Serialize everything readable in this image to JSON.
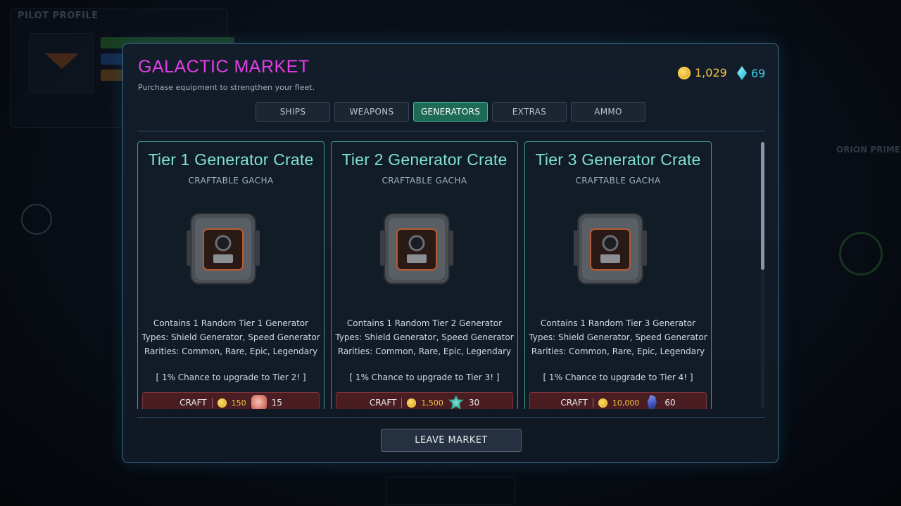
{
  "background": {
    "pilot_profile_title": "PILOT PROFILE",
    "location_name": "ORION PRIME"
  },
  "market": {
    "title": "GALACTIC MARKET",
    "subtitle": "Purchase equipment to strengthen your fleet.",
    "currency": {
      "gold": "1,029",
      "gems": "69"
    },
    "tabs": [
      {
        "label": "SHIPS",
        "active": false
      },
      {
        "label": "WEAPONS",
        "active": false
      },
      {
        "label": "GENERATORS",
        "active": true
      },
      {
        "label": "EXTRAS",
        "active": false
      },
      {
        "label": "AMMO",
        "active": false
      }
    ],
    "cards": [
      {
        "title": "Tier 1 Generator Crate",
        "subtitle": "CRAFTABLE GACHA",
        "desc_line1": "Contains 1 Random Tier 1 Generator",
        "desc_line2": "Types: Shield Generator, Speed Generator",
        "desc_line3": "Rarities: Common, Rare, Epic, Legendary",
        "chance": "[ 1% Chance to upgrade to Tier 2! ]",
        "craft_label": "CRAFT",
        "gold_cost": "150",
        "material_cost": "15",
        "material_icon": "pink-crystal-icon"
      },
      {
        "title": "Tier 2 Generator Crate",
        "subtitle": "CRAFTABLE GACHA",
        "desc_line1": "Contains 1 Random Tier 2 Generator",
        "desc_line2": "Types: Shield Generator, Speed Generator",
        "desc_line3": "Rarities: Common, Rare, Epic, Legendary",
        "chance": "[ 1% Chance to upgrade to Tier 3! ]",
        "craft_label": "CRAFT",
        "gold_cost": "1,500",
        "material_cost": "30",
        "material_icon": "teal-crystal-icon"
      },
      {
        "title": "Tier 3 Generator Crate",
        "subtitle": "CRAFTABLE GACHA",
        "desc_line1": "Contains 1 Random Tier 3 Generator",
        "desc_line2": "Types: Shield Generator, Speed Generator",
        "desc_line3": "Rarities: Common, Rare, Epic, Legendary",
        "chance": "[ 1% Chance to upgrade to Tier 4! ]",
        "craft_label": "CRAFT",
        "gold_cost": "10,000",
        "material_cost": "60",
        "material_icon": "blue-crystal-icon"
      }
    ],
    "leave_label": "LEAVE MARKET"
  }
}
